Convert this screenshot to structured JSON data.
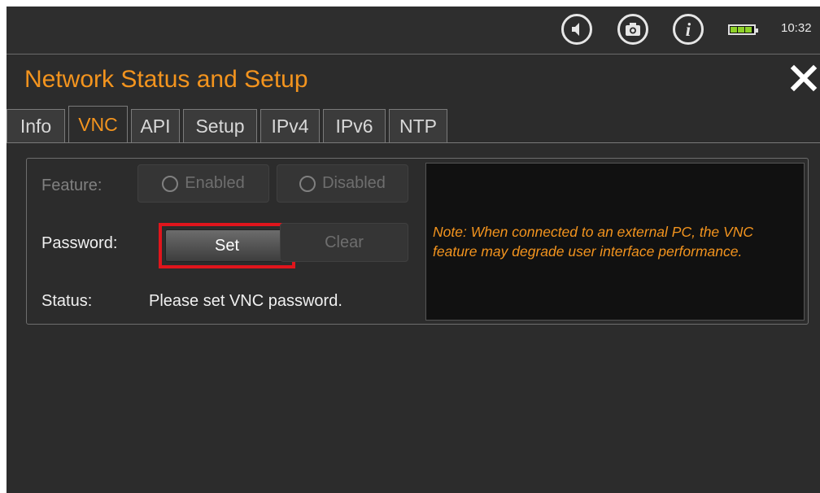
{
  "statusbar": {
    "time": "10:32",
    "icons": [
      "speaker-icon",
      "camera-icon",
      "info-icon",
      "battery-icon"
    ],
    "battery_level": 0.75
  },
  "window": {
    "title": "Network Status and Setup",
    "close_icon": "close-icon"
  },
  "tabs": [
    {
      "label": "Info",
      "active": false
    },
    {
      "label": "VNC",
      "active": true
    },
    {
      "label": "API",
      "active": false
    },
    {
      "label": "Setup",
      "active": false
    },
    {
      "label": "IPv4",
      "active": false
    },
    {
      "label": "IPv6",
      "active": false
    },
    {
      "label": "NTP",
      "active": false
    }
  ],
  "vnc": {
    "feature_label": "Feature:",
    "enabled_label": "Enabled",
    "disabled_label": "Disabled",
    "password_label": "Password:",
    "set_label": "Set",
    "clear_label": "Clear",
    "status_label": "Status:",
    "status_value": "Please set VNC password.",
    "note": "Note: When connected to an external PC, the VNC feature may degrade user interface performance."
  },
  "colors": {
    "accent": "#f3941e",
    "background": "#2c2c2c",
    "highlight": "#e0151c",
    "battery": "#8fd12a"
  }
}
